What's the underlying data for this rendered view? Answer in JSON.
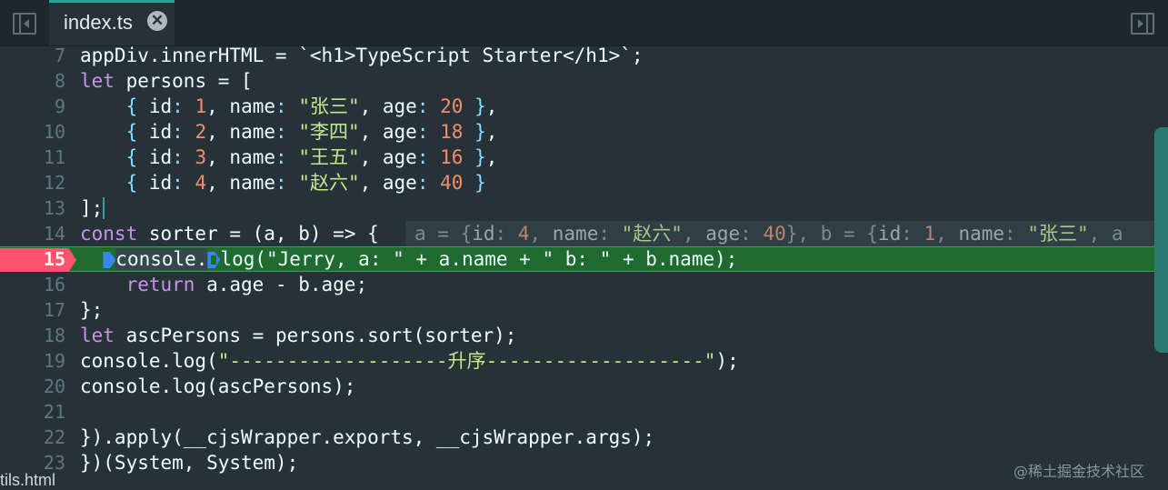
{
  "tabbar": {
    "active_tab_label": "index.ts",
    "close_glyph": "✕"
  },
  "editor": {
    "active_line": "15",
    "lines": [
      {
        "n": "7"
      },
      {
        "n": "8"
      },
      {
        "n": "9"
      },
      {
        "n": "10"
      },
      {
        "n": "11"
      },
      {
        "n": "12"
      },
      {
        "n": "13"
      },
      {
        "n": "14"
      },
      {
        "n": "15"
      },
      {
        "n": "16"
      },
      {
        "n": "17"
      },
      {
        "n": "18"
      },
      {
        "n": "19"
      },
      {
        "n": "20"
      },
      {
        "n": "21"
      },
      {
        "n": "22"
      },
      {
        "n": "23"
      }
    ],
    "code": {
      "l7": "appDiv.innerHTML = `<h1>TypeScript Starter</h1>`;",
      "l8_kw": "let",
      "l8_rest": " persons = [",
      "persons": [
        {
          "id": "1",
          "name": "\"张三\"",
          "age": "20"
        },
        {
          "id": "2",
          "name": "\"李四\"",
          "age": "18"
        },
        {
          "id": "3",
          "name": "\"王五\"",
          "age": "16"
        },
        {
          "id": "4",
          "name": "\"赵六\"",
          "age": "40"
        }
      ],
      "l13": "];",
      "l14_kw": "const",
      "l14_rest": " sorter = (a, b) => {",
      "l15_a": "console.",
      "l15_b": "log(\"Jerry, a: \" + a.name + \" b: \" + b.name);",
      "l16_kw": "return",
      "l16_rest": " a.age - b.age;",
      "l17": "};",
      "l18_kw": "let",
      "l18_rest": " ascPersons = persons.sort(sorter);",
      "l19_a": "console.log(",
      "l19_str": "\"-------------------升序-------------------\"",
      "l19_b": ");",
      "l20": "console.log(ascPersons);",
      "l21": "",
      "l22": "}).apply(__cjsWrapper.exports, __cjsWrapper.args);",
      "l23": "})(System, System);"
    },
    "inline_hint": {
      "a_label": "a = {",
      "a_id_key": "id",
      "a_id_val": "4",
      "a_name_key": "name",
      "a_name_val": "\"赵六\"",
      "a_age_key": "age",
      "a_age_val": "40",
      "b_label": "}, b = {",
      "b_id_key": "id",
      "b_id_val": "1",
      "b_name_key": "name",
      "b_name_val": "\"张三\"",
      "b_tail": ", a"
    }
  },
  "bottom_tab": {
    "label": "tils.html"
  },
  "watermark": {
    "text": "@稀土掘金技术社区"
  },
  "colors": {
    "background": "#263238",
    "keyword": "#c792ea",
    "string": "#c3e88d",
    "number": "#f78c6c",
    "breakpoint": "#ff5370",
    "current_line": "#1f6a2e",
    "accent": "#26a69a"
  }
}
